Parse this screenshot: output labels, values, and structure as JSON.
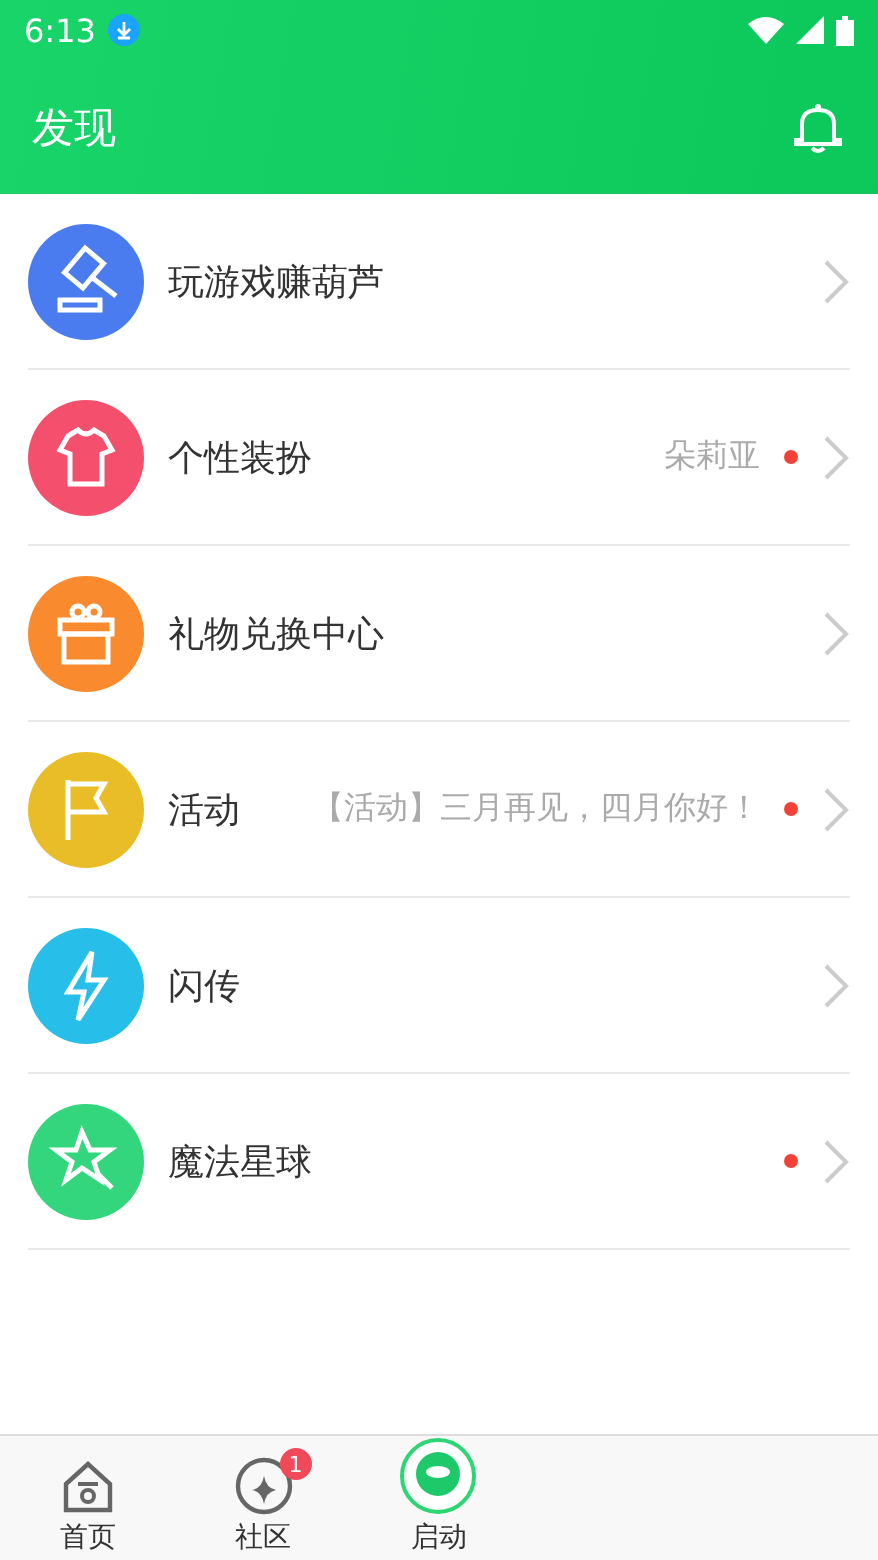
{
  "status_bar": {
    "time": "6:13"
  },
  "header": {
    "title": "发现"
  },
  "rows": [
    {
      "label": "玩游戏赚葫芦",
      "dot": false,
      "color": "#4a7cf0"
    },
    {
      "label": "个性装扮",
      "note": "朵莉亚",
      "dot": true,
      "color": "#f4506e"
    },
    {
      "label": "礼物兑换中心",
      "dot": false,
      "color": "#f98a2e"
    },
    {
      "label": "活动",
      "note": "【活动】三月再见，四月你好！",
      "dot": true,
      "color": "#e9bd28"
    },
    {
      "label": "闪传",
      "dot": false,
      "color": "#27bfe9"
    },
    {
      "label": "魔法星球",
      "dot": true,
      "color": "#33d67c"
    }
  ],
  "tab_bar": [
    {
      "label": "首页",
      "kind": "home"
    },
    {
      "label": "社区",
      "kind": "community",
      "badge": "1"
    },
    {
      "label": "启动",
      "kind": "launch"
    }
  ]
}
